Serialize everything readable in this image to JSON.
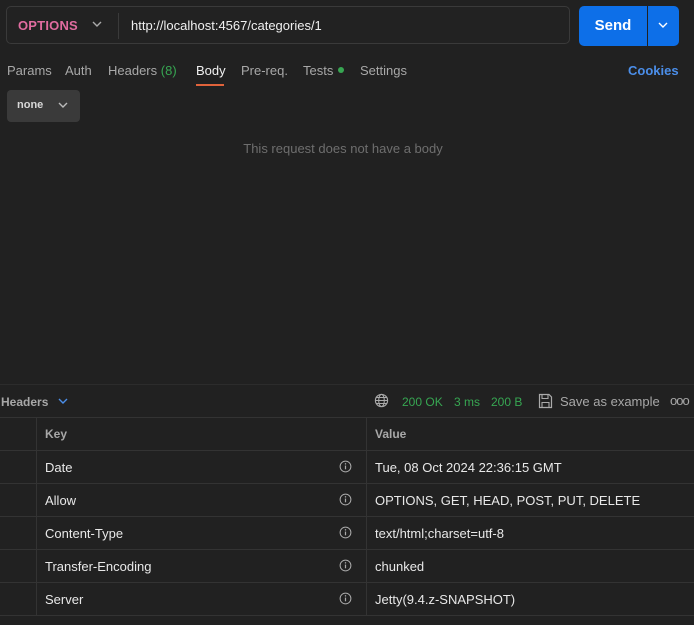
{
  "request": {
    "method": "OPTIONS",
    "url": "http://localhost:4567/categories/1",
    "send_label": "Send"
  },
  "tabs": [
    {
      "label": "Params"
    },
    {
      "label": "Auth"
    },
    {
      "label": "Headers",
      "count": "(8)"
    },
    {
      "label": "Body",
      "active": true
    },
    {
      "label": "Pre-req."
    },
    {
      "label": "Tests"
    },
    {
      "label": "Settings"
    }
  ],
  "cookies_label": "Cookies",
  "body": {
    "type": "none",
    "empty_message": "This request does not have a body"
  },
  "response": {
    "section_label": "Headers",
    "status": "200 OK",
    "time": "3 ms",
    "size": "200 B",
    "save_label": "Save as example",
    "more": "ooo",
    "columns": {
      "key": "Key",
      "value": "Value"
    },
    "headers": [
      {
        "key": "Date",
        "value": "Tue, 08 Oct 2024 22:36:15 GMT"
      },
      {
        "key": "Allow",
        "value": "OPTIONS, GET, HEAD, POST, PUT, DELETE"
      },
      {
        "key": "Content-Type",
        "value": "text/html;charset=utf-8"
      },
      {
        "key": "Transfer-Encoding",
        "value": "chunked"
      },
      {
        "key": "Server",
        "value": "Jetty(9.4.z-SNAPSHOT)"
      }
    ]
  },
  "colors": {
    "accent": "#0d6fe8",
    "method": "#e06c9f",
    "success": "#37a652",
    "active_tab_underline": "#e0633b",
    "link": "#4b8ee9"
  }
}
